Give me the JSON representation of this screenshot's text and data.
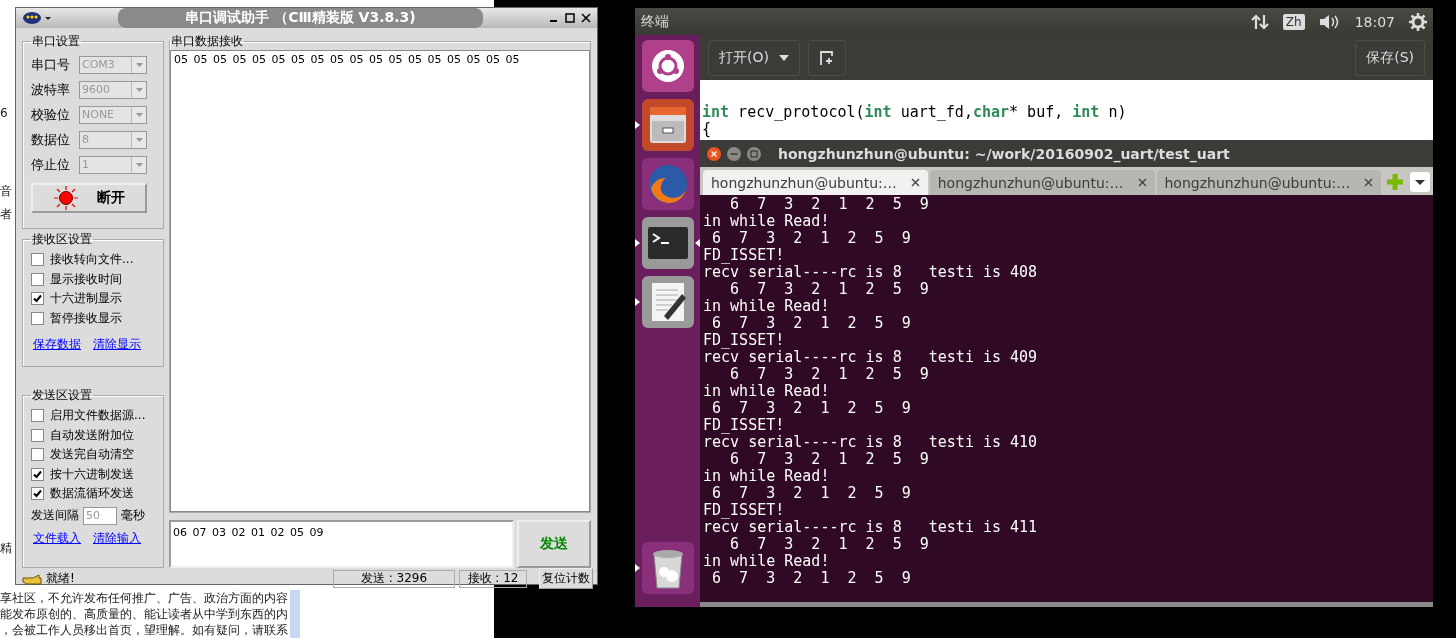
{
  "background_page": {
    "fragments": [
      "6",
      "音",
      "者",
      "精"
    ],
    "lines": [
      "享社区，不允许发布任何推广、广告、政治方面的内容",
      "能发布原创的、高质量的、能让读者从中学到东西的内",
      "，会被工作人员移出首页，望理解。如有疑问，请联系"
    ]
  },
  "serial_tool": {
    "title": "串口调试助手 （CⅢ精装版 V3.8.3)",
    "port_settings": {
      "title": "串口设置",
      "fields": [
        {
          "label": "串口号",
          "value": "COM3"
        },
        {
          "label": "波特率",
          "value": "9600"
        },
        {
          "label": "校验位",
          "value": "NONE"
        },
        {
          "label": "数据位",
          "value": "8"
        },
        {
          "label": "停止位",
          "value": "1"
        }
      ],
      "open_button": {
        "label": "断开",
        "on": true
      }
    },
    "receive_settings": {
      "title": "接收区设置",
      "options": [
        {
          "label": "接收转向文件...",
          "checked": false
        },
        {
          "label": "显示接收时间",
          "checked": false
        },
        {
          "label": "十六进制显示",
          "checked": true
        },
        {
          "label": "暂停接收显示",
          "checked": false
        }
      ],
      "links": [
        "保存数据",
        "清除显示"
      ]
    },
    "send_settings": {
      "title": "发送区设置",
      "options": [
        {
          "label": "启用文件数据源...",
          "checked": false
        },
        {
          "label": "自动发送附加位",
          "checked": false
        },
        {
          "label": "发送完自动清空",
          "checked": false
        },
        {
          "label": "按十六进制发送",
          "checked": true
        },
        {
          "label": "数据流循环发送",
          "checked": true
        }
      ],
      "interval": {
        "label": "发送间隔",
        "value": "50",
        "unit": "毫秒"
      },
      "links": [
        "文件载入",
        "清除输入"
      ]
    },
    "receive": {
      "title": "串口数据接收",
      "text": "05 05 05 05 05 05 05 05 05 05 05 05 05 05 05 05 05 05"
    },
    "send_input": {
      "value": "06 07 03 02 01 02 05 09"
    },
    "send_button": "发送",
    "status": {
      "message": "就绪!",
      "sent": "发送 : 3296",
      "received": "接收 : 12",
      "reset": "复位计数"
    }
  },
  "ubuntu": {
    "topbar": {
      "title": "终端",
      "ime": "Zh",
      "time": "18:07"
    },
    "launcher": [
      {
        "kind": "ubuntu",
        "running": false,
        "focused": false
      },
      {
        "kind": "files",
        "running": true,
        "focused": false
      },
      {
        "kind": "firefox",
        "running": false,
        "focused": false
      },
      {
        "kind": "terminal",
        "running": true,
        "focused": true
      },
      {
        "kind": "editor",
        "running": true,
        "focused": false
      },
      {
        "kind": "trash",
        "running": true,
        "focused": false
      }
    ],
    "editor": {
      "open_button": "打开(O)",
      "save_button": "保存(S)",
      "code_lines": [
        [
          {
            "text": "int",
            "kind": "keyword"
          },
          {
            "text": " recv_protocol(",
            "kind": "plain"
          },
          {
            "text": "int",
            "kind": "keyword"
          },
          {
            "text": " uart_fd,",
            "kind": "plain"
          },
          {
            "text": "char",
            "kind": "keyword"
          },
          {
            "text": "* buf, ",
            "kind": "plain"
          },
          {
            "text": "int",
            "kind": "keyword"
          },
          {
            "text": " n)",
            "kind": "plain"
          }
        ],
        [
          {
            "text": "{",
            "kind": "plain"
          }
        ]
      ]
    },
    "terminal": {
      "title": "hongzhunzhun@ubuntu: ~/work/20160902_uart/test_uart",
      "tabs": [
        {
          "label": "hongzhunzhun@ubuntu:…",
          "selected": true
        },
        {
          "label": "hongzhunzhun@ubuntu:…",
          "selected": false
        },
        {
          "label": "hongzhunzhun@ubuntu:…",
          "selected": false
        }
      ],
      "lines": [
        "   6  7  3  2  1  2  5  9",
        "in while Read!",
        " 6  7  3  2  1  2  5  9",
        "FD_ISSET!",
        "recv serial----rc is 8   testi is 408",
        "   6  7  3  2  1  2  5  9",
        "in while Read!",
        " 6  7  3  2  1  2  5  9",
        "FD_ISSET!",
        "recv serial----rc is 8   testi is 409",
        "   6  7  3  2  1  2  5  9",
        "in while Read!",
        " 6  7  3  2  1  2  5  9",
        "FD_ISSET!",
        "recv serial----rc is 8   testi is 410",
        "   6  7  3  2  1  2  5  9",
        "in while Read!",
        " 6  7  3  2  1  2  5  9",
        "FD_ISSET!",
        "recv serial----rc is 8   testi is 411",
        "   6  7  3  2  1  2  5  9",
        "in while Read!",
        " 6  7  3  2  1  2  5  9"
      ]
    }
  }
}
